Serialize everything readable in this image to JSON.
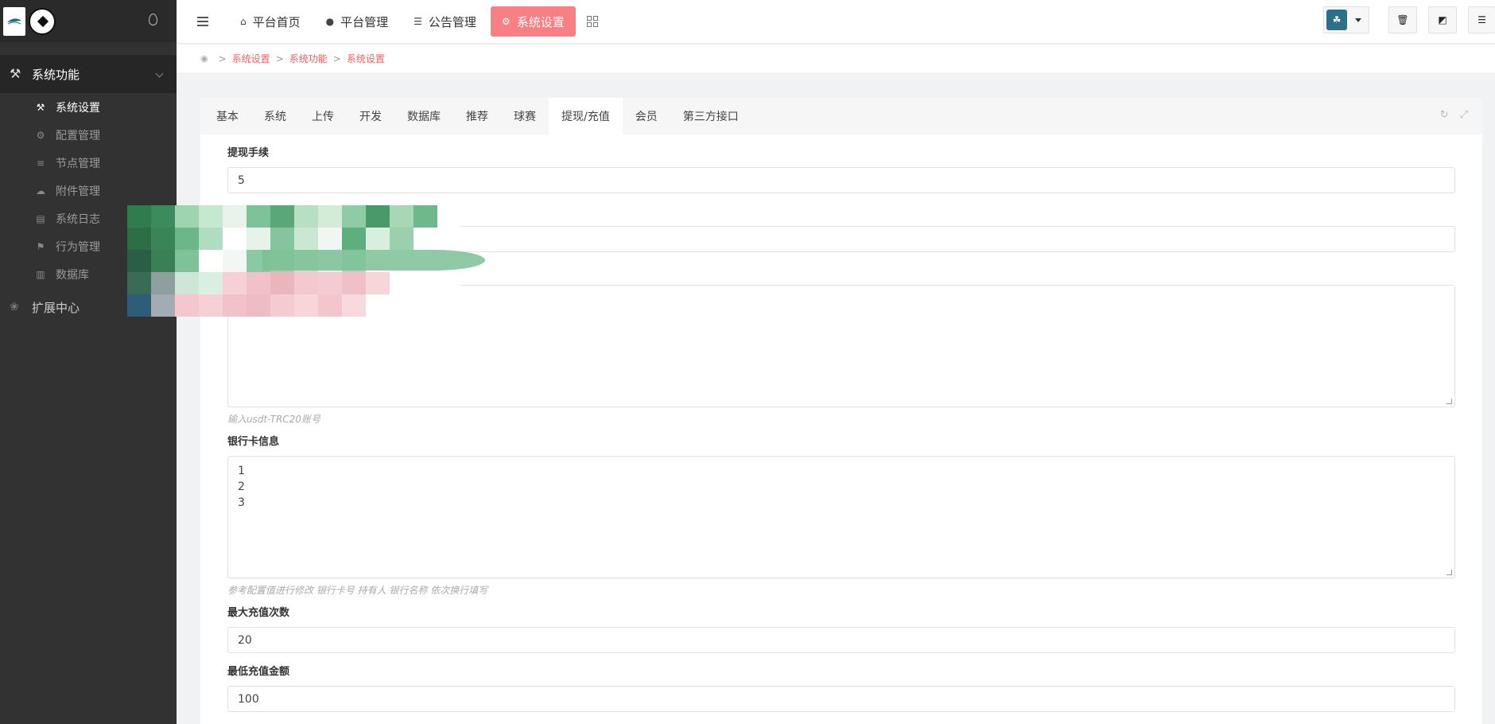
{
  "sidebar": {
    "group_system": "系统功能",
    "items": [
      {
        "label": "系统设置",
        "icon": "wrench-icon",
        "active": true
      },
      {
        "label": "配置管理",
        "icon": "cogs-icon",
        "active": false
      },
      {
        "label": "节点管理",
        "icon": "list-icon",
        "active": false
      },
      {
        "label": "附件管理",
        "icon": "cloud-icon",
        "active": false
      },
      {
        "label": "系统日志",
        "icon": "log-icon",
        "active": false
      },
      {
        "label": "行为管理",
        "icon": "behavior-icon",
        "active": false
      },
      {
        "label": "数据库",
        "icon": "database-icon",
        "active": false
      }
    ],
    "group_extend": "扩展中心"
  },
  "header": {
    "nav": [
      {
        "label": "平台首页",
        "icon": "home-icon"
      },
      {
        "label": "平台管理",
        "icon": "user-icon"
      },
      {
        "label": "公告管理",
        "icon": "list-indent-icon"
      },
      {
        "label": "系统设置",
        "icon": "gear-icon",
        "active": true
      }
    ]
  },
  "breadcrumb": [
    "系统设置",
    "系统功能",
    "系统设置"
  ],
  "tabs": [
    "基本",
    "系统",
    "上传",
    "开发",
    "数据库",
    "推荐",
    "球赛",
    "提现/充值",
    "会员",
    "第三方接口"
  ],
  "active_tab": "提现/充值",
  "form": {
    "withdraw_fee_label": "提现手续",
    "withdraw_fee_value": "5",
    "usdt_help": "输入usdt-TRC20账号",
    "bank_label": "银行卡信息",
    "bank_value": "1\n2\n3",
    "bank_help": "参考配置值进行修改 银行卡号 持有人 银行名称 依次换行填写",
    "max_recharge_label": "最大充值次数",
    "max_recharge_value": "20",
    "min_recharge_label": "最低充值金额",
    "min_recharge_value": "100"
  },
  "colors": {
    "accent": "#f87f83",
    "breadcrumb": "#f06263",
    "sidebar_bg": "#323232"
  }
}
